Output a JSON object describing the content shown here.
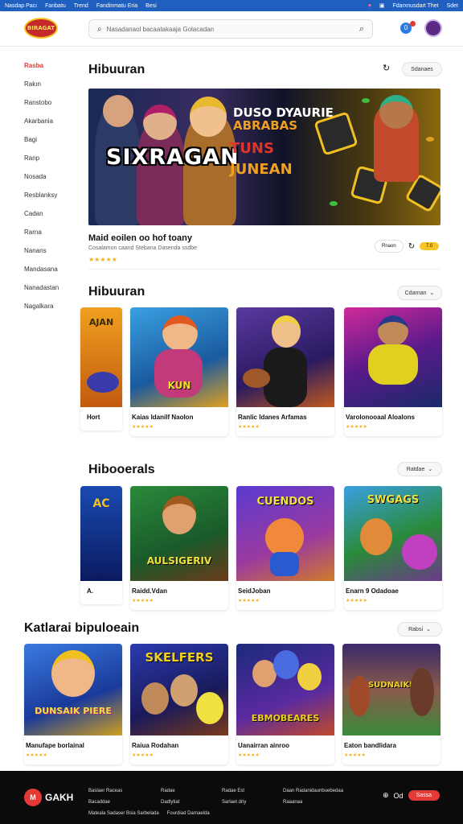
{
  "topbar": {
    "left": [
      "Nasdap Pacı",
      "Fanbatu",
      "Trend",
      "Fandinmatu Eria",
      "Besi"
    ],
    "right": "Fdarxnusdart Thet",
    "right2": "Sdet"
  },
  "header": {
    "logo_text": "BIRAGAT",
    "search_placeholder": "Nasadanaol bacaatakaaja Golacadan",
    "notification_count": "0"
  },
  "sidebar": {
    "items": [
      "Rasba",
      "Rakın",
      "Ranstobo",
      "Akarbania",
      "Bagi",
      "Ranp",
      "Nosada",
      "Resblanksy",
      "Cadan",
      "Rarna",
      "Nanans",
      "Mandasana",
      "Nanadastan",
      "Nagalkara"
    ]
  },
  "sections": {
    "hero_title": "Hibuuran",
    "hero_pill": "Sdanaes",
    "row1_title": "Hibuuran",
    "row1_pill": "Cdarnan",
    "row2_title": "Hibooerals",
    "row2_pill": "Ratdae",
    "row3_title": "Katlarai bipuloeain",
    "row3_pill": "Rabsi"
  },
  "hero": {
    "big_text": "SIXRAGAN",
    "line1": "DUSO DYAURIE",
    "line2": "ABRABAS",
    "line3": "TUNS",
    "line4": "JUNEAN",
    "info_title": "Maid eoilen oo hof toany",
    "info_sub": "Cosalamon caand  Stebana Dasenda ssdbe",
    "stars": "★★★★★",
    "info_pill": "Rnaon",
    "rating": "7.0"
  },
  "row1": [
    {
      "title": "Hort",
      "stars": "",
      "art": "AJAN"
    },
    {
      "title": "Kaias Idanilf Naolon",
      "stars": "★★★★★",
      "art": "KUN"
    },
    {
      "title": "Ranlic Idanes Arfamas",
      "stars": "★★★★★",
      "art": ""
    },
    {
      "title": "Varolonooaal Aloalons",
      "stars": "★★★★★",
      "art": ""
    }
  ],
  "row2": [
    {
      "title": "A.",
      "stars": "",
      "art": "AC"
    },
    {
      "title": "Raidd.Vdan",
      "stars": "★★★★★",
      "art": "AULSIGERIV"
    },
    {
      "title": "SeidJoban",
      "stars": "★★★★★",
      "art": "CUENDOS"
    },
    {
      "title": "Enarn 9 Odadoae",
      "stars": "★★★★★",
      "art": "SWGAGS"
    }
  ],
  "row3": [
    {
      "title": "Manufape borlainal",
      "stars": "★★★★★",
      "art": "DUNSAIK PIERE"
    },
    {
      "title": "Raiua Rodahan",
      "stars": "★★★★★",
      "art": "SKELFERS"
    },
    {
      "title": "Uanairran ainroo",
      "stars": "★★★★★",
      "art": "EBMOBEARES"
    },
    {
      "title": "Eaton bandlidara",
      "stars": "★★★★★",
      "art": "SUDNAIKE"
    }
  ],
  "footer": {
    "logo_text": "M",
    "name": "GAKH",
    "col1": [
      "Baslaer Raceas",
      "Bacaddae"
    ],
    "col2": [
      "Radae",
      "Dadlytiat"
    ],
    "col3": [
      "Radae Est",
      "Sarlaet driy"
    ],
    "col4": [
      "Daan Radanidaunbuebedaa",
      "Raaanaa"
    ],
    "bottom": [
      "Mateala Sadaser Bsia Sarbelada",
      "Fourdiad Darnaelda"
    ],
    "right_text": "Od",
    "button": "Sassa"
  }
}
